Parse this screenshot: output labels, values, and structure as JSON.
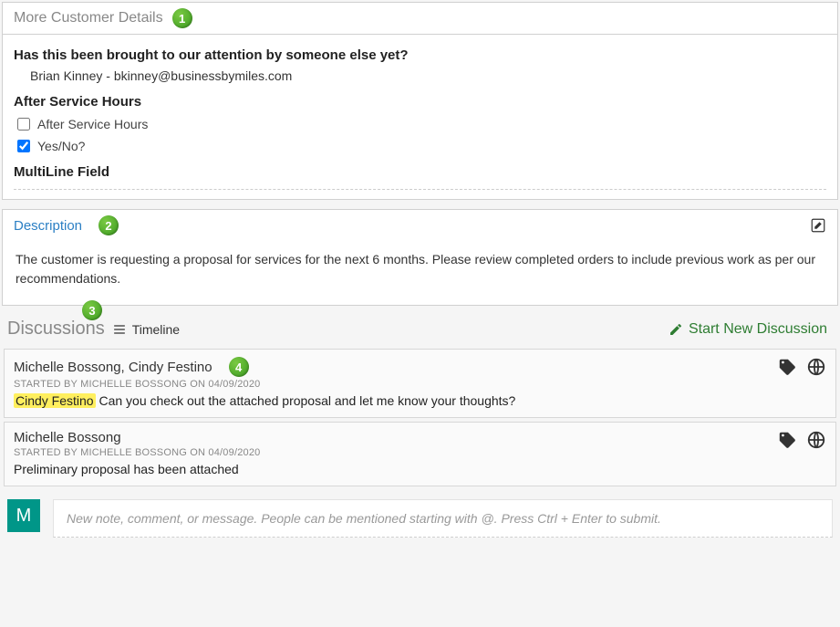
{
  "badges": {
    "b1": "1",
    "b2": "2",
    "b3": "3",
    "b4": "4"
  },
  "details": {
    "title": "More Customer Details",
    "q1": "Has this been brought to our attention by someone else yet?",
    "a1": "Brian Kinney - bkinney@businessbymiles.com",
    "q2": "After Service Hours",
    "chk1_label": "After Service Hours",
    "chk1_checked": false,
    "chk2_label": "Yes/No?",
    "chk2_checked": true,
    "q3": "MultiLine Field"
  },
  "description": {
    "title": "Description",
    "body": "The customer is requesting a proposal for services for the next 6 months. Please review completed orders to include previous work as per our recommendations."
  },
  "discussions": {
    "title": "Discussions",
    "timeline_label": "Timeline",
    "start_new_label": "Start New Discussion",
    "items": [
      {
        "participants": "Michelle Bossong, Cindy Festino",
        "meta": "STARTED BY MICHELLE BOSSONG ON 04/09/2020",
        "mention": "Cindy Festino",
        "message_rest": " Can you check out the attached proposal and let me know your thoughts?"
      },
      {
        "participants": "Michelle Bossong",
        "meta": "STARTED BY MICHELLE BOSSONG ON 04/09/2020",
        "mention": "",
        "message_rest": "Preliminary proposal has been attached"
      }
    ],
    "compose_placeholder": "New note, comment, or message. People can be mentioned starting with @. Press Ctrl + Enter to submit.",
    "avatar_initial": "M"
  }
}
